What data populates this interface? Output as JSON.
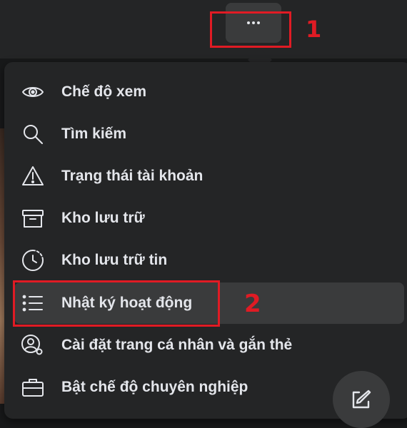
{
  "header": {
    "more_button_icon": "more-horizontal-icon"
  },
  "annotations": {
    "first": "1",
    "second": "2",
    "color": "#e01b24"
  },
  "menu": {
    "items": [
      {
        "label": "Chế độ xem",
        "icon": "eye-icon"
      },
      {
        "label": "Tìm kiếm",
        "icon": "search-icon"
      },
      {
        "label": "Trạng thái tài khoản",
        "icon": "warning-icon"
      },
      {
        "label": "Kho lưu trữ",
        "icon": "archive-icon"
      },
      {
        "label": "Kho lưu trữ tin",
        "icon": "story-archive-icon"
      },
      {
        "label": "Nhật ký hoạt động",
        "icon": "list-icon",
        "highlighted": true
      },
      {
        "label": "Cài đặt trang cá nhân và gắn thẻ",
        "icon": "profile-settings-icon"
      },
      {
        "label": "Bật chế độ chuyên nghiệp",
        "icon": "briefcase-icon"
      }
    ]
  },
  "fab": {
    "icon": "edit-icon"
  },
  "colors": {
    "background": "#18191a",
    "menu": "#242526",
    "highlight": "#3a3b3c",
    "text": "#e4e6eb"
  }
}
